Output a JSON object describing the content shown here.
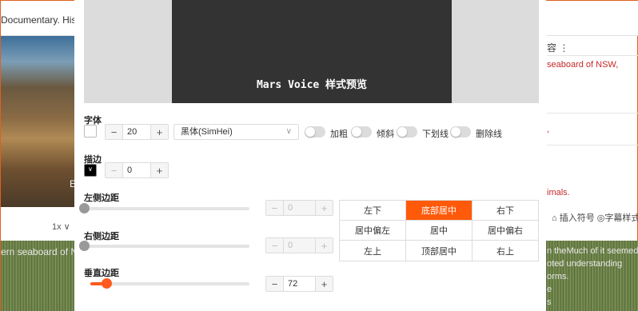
{
  "background": {
    "title_fragment": "Documentary. Histo",
    "photo_letter": "E",
    "speed": "1x ∨",
    "wave_text_left": "ern seaboard of N",
    "wave_text_right_1": "n theMuch of it seemed",
    "wave_text_right_2": "oted understanding",
    "wave_text_right_3": "orms.",
    "wave_text_right_4": "e",
    "wave_text_right_5": "s",
    "right_menu": "容 ⋮",
    "red_text_1": "seaboard of NSW,",
    "red_text_2": ",",
    "red_text_3": "imals.",
    "tools": "⌂ 插入符号  ◎字幕样式  ⊟"
  },
  "preview": {
    "text": "Mars Voice 样式预览"
  },
  "font": {
    "label": "字体",
    "color": "#ffffff",
    "size": "20",
    "family": "黑体(SimHei)",
    "options": [
      {
        "label": "加粗",
        "on": false
      },
      {
        "label": "倾斜",
        "on": false
      },
      {
        "label": "下划线",
        "on": false
      },
      {
        "label": "删除线",
        "on": false
      }
    ]
  },
  "stroke": {
    "label": "描边",
    "color": "#000000",
    "width": "0"
  },
  "margins": {
    "left": {
      "label": "左侧边距",
      "value": "0",
      "fraction": 0.0
    },
    "right": {
      "label": "右侧边距",
      "value": "0",
      "fraction": 0.0
    },
    "vertical": {
      "label": "垂直边距",
      "value": "72",
      "fraction": 0.1
    }
  },
  "position_grid": {
    "cells": [
      "左下",
      "底部居中",
      "右下",
      "居中偏左",
      "居中",
      "居中偏右",
      "左上",
      "顶部居中",
      "右上"
    ],
    "selected": "底部居中"
  },
  "icons": {
    "minus": "−",
    "plus": "+",
    "chevron": "∨"
  },
  "accent_color": "#ff5a0a"
}
